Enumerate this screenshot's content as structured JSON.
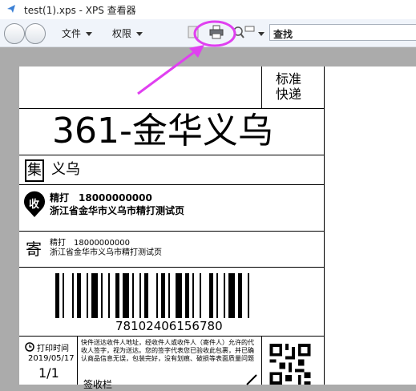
{
  "window": {
    "title": "test(1).xps - XPS 查看器"
  },
  "toolbar": {
    "file_menu": "文件",
    "perm_menu": "权限",
    "search_label": "查找"
  },
  "label": {
    "service": "标准\n快递",
    "sort_code": "361-金华义乌",
    "collect_badge": "集",
    "collect_city": "义乌",
    "recv_badge": "收",
    "recv_name_phone": "精打　18000000000",
    "recv_address": "浙江省金华市义乌市精打测试页",
    "send_badge": "寄",
    "send_name_phone": "精打　18000000000",
    "send_address": "浙江省金华市义乌市精打测试页",
    "tracking": "78102406156780",
    "print_time_label": "打印时间",
    "print_date": "2019/05/17",
    "page_count": "1/1",
    "signature_label": "签收栏",
    "terms": "快件送达收件人地址，经收件人或收件人（寄件人）允许的代收人签字，视为送达。您的签字代表您已验收此包裹，并已确认商品信息无误，包装完好，没有划痕、破损等表面质量问题",
    "barcode_pattern": [
      2,
      1,
      1,
      3,
      1,
      1,
      2,
      2,
      1,
      1,
      3,
      1,
      1,
      2,
      1,
      2,
      2,
      1,
      3,
      1,
      1,
      2,
      1,
      1,
      2,
      3,
      1,
      1,
      2,
      1,
      1,
      2,
      3,
      1,
      2,
      1,
      1,
      2,
      1,
      3,
      2,
      1,
      1,
      2,
      1,
      1,
      3,
      1,
      2,
      2,
      1,
      1
    ]
  },
  "colors": {
    "annotation": "#e040f0",
    "toolbar_bg": "#f0f4fa",
    "viewer_bg": "#ababab"
  }
}
